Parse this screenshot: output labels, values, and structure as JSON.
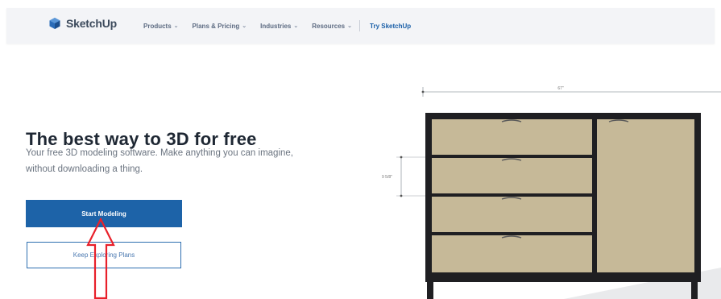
{
  "navbar": {
    "brand": "SketchUp",
    "items": [
      {
        "label": "Products"
      },
      {
        "label": "Plans & Pricing"
      },
      {
        "label": "Industries"
      },
      {
        "label": "Resources"
      }
    ],
    "cta": "Try SketchUp"
  },
  "hero": {
    "title": "The best way to 3D for free",
    "subtitle": "Your free 3D modeling software. Make anything you can imagine, without downloading a thing.",
    "primary_button": "Start Modeling",
    "secondary_button": "Keep Exploring Plans"
  },
  "illustration": {
    "width_dimension": "67\"",
    "drawer_dimension": "9 5/8\""
  },
  "colors": {
    "brand_blue": "#1d63a8",
    "cabinet_frame": "#1f1f22",
    "cabinet_panel": "#c6b998",
    "annotation_red": "#e8202a"
  },
  "icons": {
    "logo": "sketchup-logo-icon",
    "annotation": "red-arrow-annotation-icon"
  }
}
